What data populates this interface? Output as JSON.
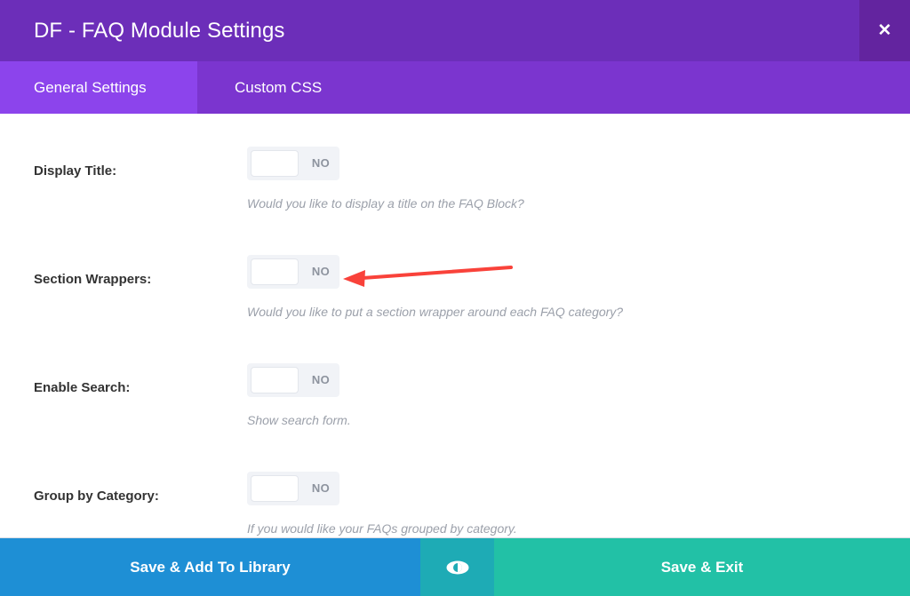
{
  "header": {
    "title": "DF - FAQ Module Settings",
    "close_label": "✕",
    "bg_color": "#6C2EB9",
    "close_bg_color": "#63249F"
  },
  "tabs": [
    {
      "label": "General Settings",
      "active": true
    },
    {
      "label": "Custom CSS",
      "active": false
    }
  ],
  "tab_bar": {
    "bg_color": "#7B35CF",
    "active_color": "#8C44EC"
  },
  "fields": [
    {
      "label": "Display Title:",
      "toggle_state": "NO",
      "description": "Would you like to display a title on the FAQ Block?"
    },
    {
      "label": "Section Wrappers:",
      "toggle_state": "NO",
      "description": "Would you like to put a section wrapper around each FAQ category?"
    },
    {
      "label": "Enable Search:",
      "toggle_state": "NO",
      "description": "Show search form."
    },
    {
      "label": "Group by Category:",
      "toggle_state": "NO",
      "description": "If you would like your FAQs grouped by category."
    }
  ],
  "annotation": {
    "type": "arrow",
    "color": "#F9423A",
    "points_to": "Section Wrappers toggle"
  },
  "footer": {
    "save_library_label": "Save & Add To Library",
    "preview_icon": "eye-icon",
    "save_exit_label": "Save & Exit",
    "library_color": "#1E8FD5",
    "preview_color": "#1EABB5",
    "exit_color": "#22C1A6"
  }
}
